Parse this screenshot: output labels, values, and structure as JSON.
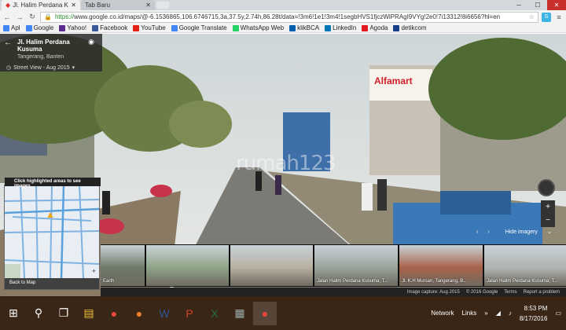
{
  "browser": {
    "tabs": [
      {
        "title": "Jl. Halim Perdana Ku",
        "active": true
      },
      {
        "title": "Tab Baru",
        "active": false
      }
    ],
    "url_scheme": "https://",
    "url_rest": "www.google.co.id/maps/@-6.1536865,106.6746715,3a,37.5y,2.74h,86.28t/data=!3m6!1e1!3m4!1segbHVS1fjczWiPRAgI9VYg!2e0!7i13312!8i6656?hl=en",
    "bookmarks": [
      {
        "label": "Apl",
        "icon": "apps-icon",
        "color": "#4285f4"
      },
      {
        "label": "Google",
        "icon": "google-icon",
        "color": "#4285f4"
      },
      {
        "label": "Yahoo!",
        "icon": "yahoo-icon",
        "color": "#5c2d91"
      },
      {
        "label": "Facebook",
        "icon": "facebook-icon",
        "color": "#3b5998"
      },
      {
        "label": "YouTube",
        "icon": "youtube-icon",
        "color": "#e62117"
      },
      {
        "label": "Google Translate",
        "icon": "translate-icon",
        "color": "#4285f4"
      },
      {
        "label": "WhatsApp Web",
        "icon": "whatsapp-icon",
        "color": "#25d366"
      },
      {
        "label": "klikBCA",
        "icon": "bca-icon",
        "color": "#0060af"
      },
      {
        "label": "LinkedIn",
        "icon": "linkedin-icon",
        "color": "#0077b5"
      },
      {
        "label": "Agoda",
        "icon": "agoda-icon",
        "color": "#e21b22"
      },
      {
        "label": "detikcom",
        "icon": "detik-icon",
        "color": "#1a3e8c"
      }
    ]
  },
  "streetview": {
    "place": "Jl. Halim Perdana Kusuma",
    "region": "Tangerang, Banten",
    "date": "Street View - Aug 2015",
    "map_hint": "Click highlighted areas to see images",
    "back_to_map": "Back to Map",
    "hide_imagery": "Hide imagery",
    "watermark": "rumah123",
    "thumbs": [
      {
        "caption": "Earth",
        "width": 56,
        "color": "#6e7a66"
      },
      {
        "caption": "",
        "width": 105,
        "color": "#8fa488"
      },
      {
        "caption": "",
        "width": 105,
        "color": "#b8b0a0"
      },
      {
        "caption": "Jalan Halim Perdana Kusuma, T...",
        "width": 106,
        "color": "#9aa49a"
      },
      {
        "caption": "Jl. K.H Mursan, Tangerang, B...",
        "width": 106,
        "color": "#a8624a"
      },
      {
        "caption": "Jalan Halim Perdana Kusuma, T...",
        "width": 106,
        "color": "#b0b4b0"
      }
    ],
    "credits": [
      "Image capture: Aug 2015",
      "© 2016 Google",
      "Terms",
      "Report a problem"
    ]
  },
  "taskbar": {
    "network_label": "Network",
    "links_label": "Links",
    "time": "8:53 PM",
    "date": "8/17/2016"
  }
}
